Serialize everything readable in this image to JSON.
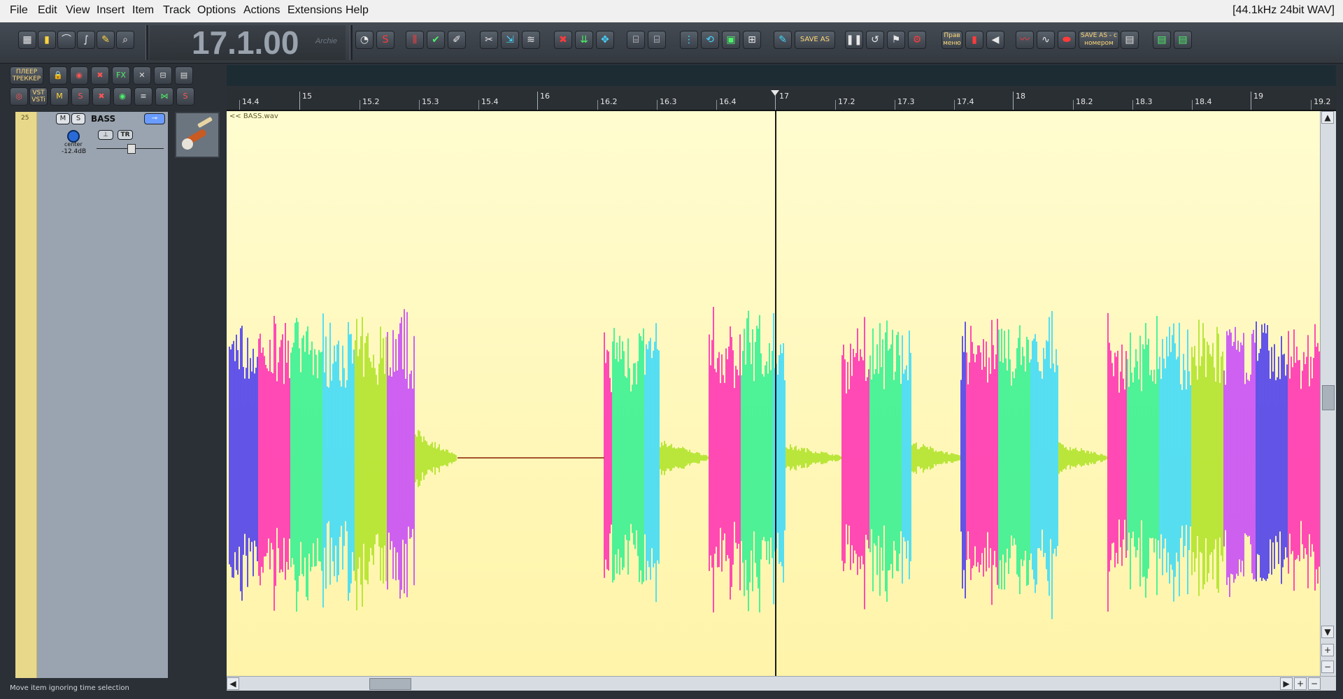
{
  "menubar": {
    "items": [
      "File",
      "Edit",
      "View",
      "Insert",
      "Item",
      "Track",
      "Options",
      "Actions",
      "Extensions",
      "Help"
    ],
    "status": "[44.1kHz 24bit WAV]"
  },
  "transport": {
    "time": "17.1.00",
    "theme_name": "Archie",
    "save_as_label": "SAVE AS",
    "save_as_numbered_label": "SAVE AS - с номером",
    "prav_label": "Прав меню"
  },
  "panel": {
    "player_tracker_label": "ПЛЕЕР ТРЕККЕР",
    "vst_label": "VST VSTi"
  },
  "track": {
    "number": "25",
    "mute_label": "M",
    "solo_label": "S",
    "name": "BASS",
    "pan_text": "center",
    "volume_text": "-12.4dB",
    "tr_label": "TR",
    "item_name": "<< BASS.wav"
  },
  "ruler": {
    "labels": [
      "14.4",
      "15",
      "15.2",
      "15.3",
      "15.4",
      "16",
      "16.2",
      "16.3",
      "16.4",
      "17",
      "17.2",
      "17.3",
      "17.4",
      "18",
      "18.2",
      "18.3",
      "18.4",
      "19",
      "19.2"
    ]
  },
  "status": {
    "text": "Move item ignoring time selection"
  },
  "colors": {
    "item_background": "#fff7b8",
    "track_color": "#e7d88a",
    "waveform": [
      "#3b2cf2",
      "#ff1fb4",
      "#22f08e",
      "#2bd8ff",
      "#a8e21c",
      "#c23bff"
    ]
  }
}
